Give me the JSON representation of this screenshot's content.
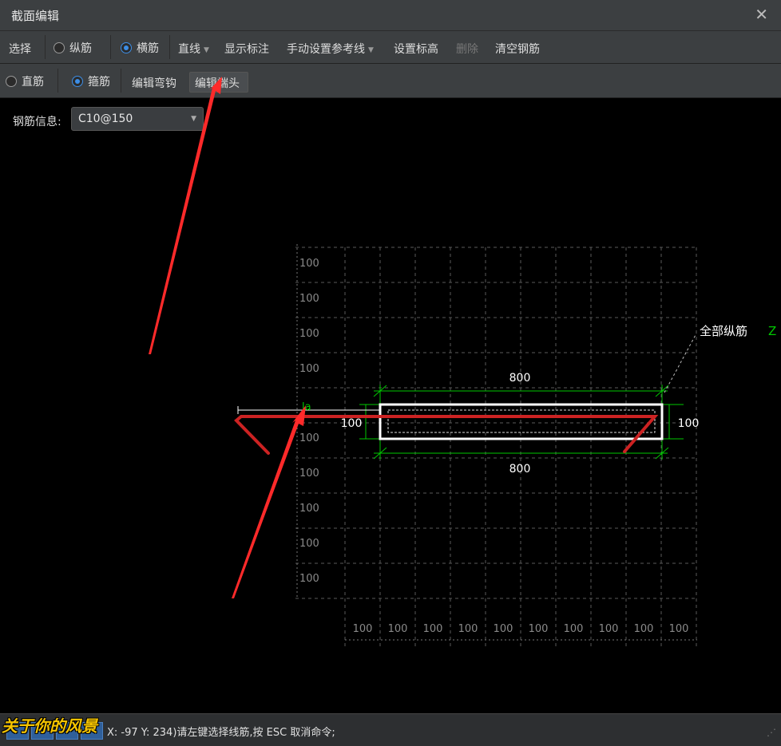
{
  "window": {
    "title": "截面编辑",
    "close_icon": "close-icon"
  },
  "toolbar1": {
    "select": "选择",
    "longitudinal": "纵筋",
    "transverse": "横筋",
    "line": "直线",
    "show_annotation": "显示标注",
    "manual_ref": "手动设置参考线",
    "set_elevation": "设置标高",
    "delete": "删除",
    "clear": "清空钢筋"
  },
  "toolbar2": {
    "straight": "直筋",
    "stirrup": "箍筋",
    "edit_hook": "编辑弯钩",
    "edit_end": "编辑端头"
  },
  "rebar_info": {
    "label": "钢筋信息:",
    "value": "C10@150"
  },
  "drawing": {
    "grid_label": "100",
    "dim_top": "800",
    "dim_bottom": "800",
    "dim_left": "100",
    "dim_right": "100",
    "la_label": "la",
    "leader_label": "全部纵筋",
    "leader_suffix": "Z",
    "colors": {
      "dim": "#00c800",
      "rebar": "#cc2222",
      "outline": "#ffffff",
      "grid": "#5a5a5a",
      "arrow": "#ff2a2a"
    }
  },
  "status": {
    "message": "X: -97 Y: 234)请左键选择线筋,按 ESC 取消命令;"
  },
  "watermark": {
    "text": "关于你的风景"
  }
}
